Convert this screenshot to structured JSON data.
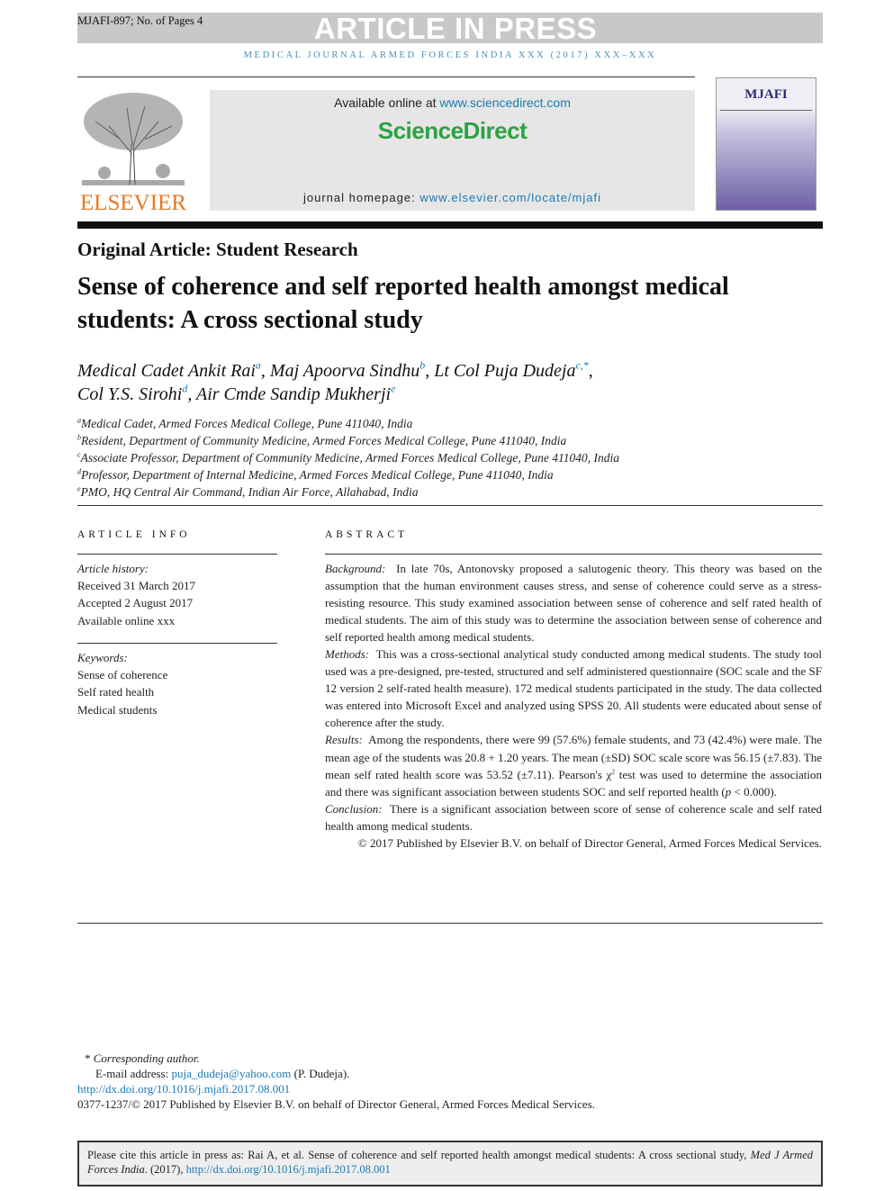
{
  "header": {
    "manuscript": "MJAFI-897; No. of Pages 4",
    "banner": "ARTICLE IN PRESS",
    "journal_line": "MEDICAL JOURNAL ARMED FORCES INDIA XXX (2017) XXX–XXX"
  },
  "publisher": {
    "logo_text": "ELSEVIER",
    "available_prefix": "Available online at ",
    "available_link": "www.sciencedirect.com",
    "brand": "ScienceDirect",
    "homepage_prefix": "journal homepage: ",
    "homepage_link": "www.elsevier.com/locate/mjafi",
    "cover_title": "MJAFI"
  },
  "article": {
    "type": "Original Article: Student Research",
    "title": "Sense of coherence and self reported health amongst medical students: A cross sectional study",
    "authors": [
      {
        "name": "Medical Cadet Ankit Rai",
        "aff": "a"
      },
      {
        "name": "Maj Apoorva Sindhu",
        "aff": "b"
      },
      {
        "name": "Lt Col Puja Dudeja",
        "aff": "c,*"
      },
      {
        "name": "Col Y.S. Sirohi",
        "aff": "d"
      },
      {
        "name": "Air Cmde Sandip Mukherji",
        "aff": "e"
      }
    ],
    "affiliations": [
      {
        "key": "a",
        "text": "Medical Cadet, Armed Forces Medical College, Pune 411040, India"
      },
      {
        "key": "b",
        "text": "Resident, Department of Community Medicine, Armed Forces Medical College, Pune 411040, India"
      },
      {
        "key": "c",
        "text": "Associate Professor, Department of Community Medicine, Armed Forces Medical College, Pune 411040, India"
      },
      {
        "key": "d",
        "text": "Professor, Department of Internal Medicine, Armed Forces Medical College, Pune 411040, India"
      },
      {
        "key": "e",
        "text": "PMO, HQ Central Air Command, Indian Air Force, Allahabad, India"
      }
    ]
  },
  "article_info": {
    "heading": "ARTICLE INFO",
    "history_label": "Article history:",
    "history": [
      "Received 31 March 2017",
      "Accepted 2 August 2017",
      "Available online xxx"
    ],
    "keywords_label": "Keywords:",
    "keywords": [
      "Sense of coherence",
      "Self rated health",
      "Medical students"
    ]
  },
  "abstract": {
    "heading": "ABSTRACT",
    "background_label": "Background:",
    "background": "In late 70s, Antonovsky proposed a salutogenic theory. This theory was based on the assumption that the human environment causes stress, and sense of coherence could serve as a stress-resisting resource. This study examined association between sense of coherence and self rated health of medical students. The aim of this study was to determine the association between sense of coherence and self reported health among medical students.",
    "methods_label": "Methods:",
    "methods": "This was a cross-sectional analytical study conducted among medical students. The study tool used was a pre-designed, pre-tested, structured and self administered questionnaire (SOC scale and the SF 12 version 2 self-rated health measure). 172 medical students participated in the study. The data collected was entered into Microsoft Excel and analyzed using SPSS 20. All students were educated about sense of coherence after the study.",
    "results_label": "Results:",
    "results_a": "Among the respondents, there were 99 (57.6%) female students, and 73 (42.4%) were male. The mean age of the students was 20.8 + 1.20 years. The mean (±SD) SOC scale score was 56.15 (±7.83). The mean self rated health score was 53.52 (±7.11). Pearson's χ",
    "results_sup": "2",
    "results_b": " test was used to determine the association and there was significant association between students SOC and self reported health (",
    "results_p": "p",
    "results_c": " < 0.000).",
    "conclusion_label": "Conclusion:",
    "conclusion": "There is a significant association between score of sense of coherence scale and self rated health among medical students.",
    "copyright": "© 2017 Published by Elsevier B.V. on behalf of Director General, Armed Forces Medical Services."
  },
  "footnotes": {
    "corresponding": "Corresponding author.",
    "email_label": "E-mail address: ",
    "email": "puja_dudeja@yahoo.com",
    "email_suffix": " (P. Dudeja).",
    "doi": "http://dx.doi.org/10.1016/j.mjafi.2017.08.001",
    "issn": "0377-1237/© 2017 Published by Elsevier B.V. on behalf of Director General, Armed Forces Medical Services."
  },
  "citation": {
    "prefix": "Please cite this article in press as: Rai A, et al. Sense of coherence and self reported health amongst medical students: A cross sectional study, ",
    "journal": "Med J Armed Forces India",
    "year": ". (2017), ",
    "doi": "http://dx.doi.org/10.1016/j.mjafi.2017.08.001"
  }
}
